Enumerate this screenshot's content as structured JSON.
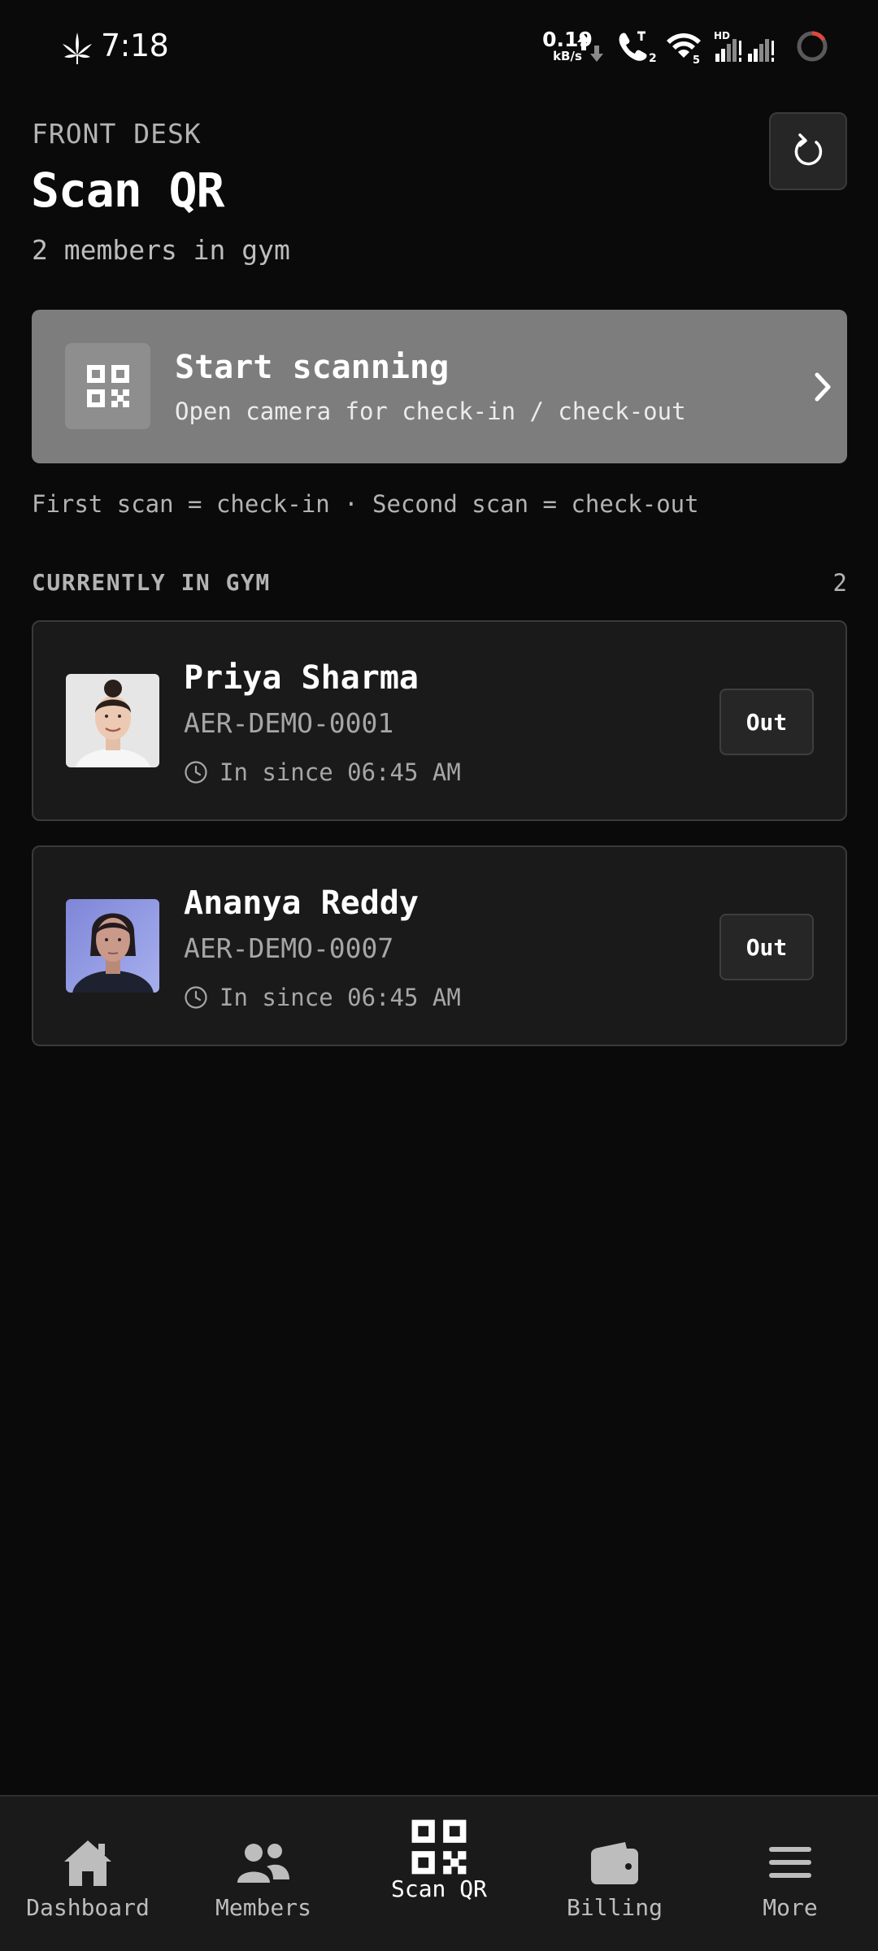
{
  "status_bar": {
    "time": "7:18",
    "net_speed_value": "0.19",
    "net_speed_unit": "kB/s",
    "call_badge": "2",
    "wifi_badge": "5",
    "network_type": "HD",
    "icons": [
      "cannabis-leaf-icon",
      "data-arrows-icon",
      "call-icon",
      "wifi-icon",
      "signal-icon",
      "battery-ring-icon"
    ]
  },
  "header": {
    "eyebrow": "FRONT DESK",
    "title": "Scan QR",
    "subtitle": "2 members in gym",
    "refresh_icon": "refresh-icon"
  },
  "scan_card": {
    "title": "Start scanning",
    "subtitle": "Open camera for check-in / check-out",
    "icon": "qr-code-icon",
    "chevron_icon": "chevron-right-icon"
  },
  "hint": "First scan = check-in · Second scan = check-out",
  "section": {
    "label": "CURRENTLY IN GYM",
    "count": "2"
  },
  "members": [
    {
      "name": "Priya Sharma",
      "id": "AER-DEMO-0001",
      "since": "In since 06:45 AM",
      "action": "Out"
    },
    {
      "name": "Ananya Reddy",
      "id": "AER-DEMO-0007",
      "since": "In since 06:45 AM",
      "action": "Out"
    }
  ],
  "nav": {
    "items": [
      {
        "label": "Dashboard",
        "icon": "home-icon"
      },
      {
        "label": "Members",
        "icon": "users-icon"
      },
      {
        "label": "Scan QR",
        "icon": "qr-code-icon"
      },
      {
        "label": "Billing",
        "icon": "wallet-icon"
      },
      {
        "label": "More",
        "icon": "menu-icon"
      }
    ],
    "active": "Scan QR"
  },
  "colors": {
    "background": "#0a0a0a",
    "card": "#1a1a1a",
    "scan_card": "#7d7d7d",
    "text_muted": "#b3b3b3"
  }
}
